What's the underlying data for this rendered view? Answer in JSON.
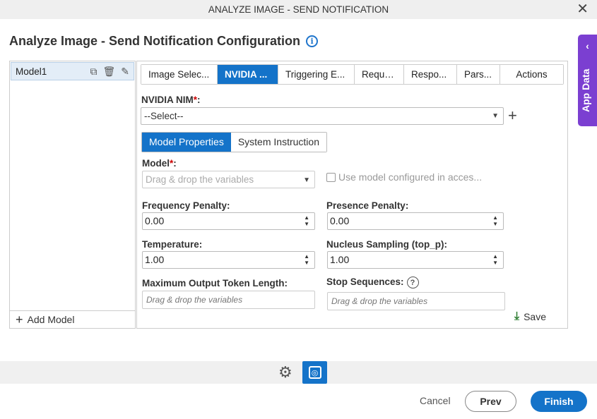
{
  "window": {
    "title": "ANALYZE IMAGE - SEND NOTIFICATION"
  },
  "page": {
    "heading": "Analyze Image - Send Notification Configuration"
  },
  "app_data": {
    "label": "App Data"
  },
  "models": {
    "items": [
      {
        "label": "Model1"
      }
    ],
    "add_label": "Add Model"
  },
  "tabs": [
    {
      "label": "Image Selec...",
      "active": false
    },
    {
      "label": "NVIDIA ...",
      "active": true
    },
    {
      "label": "Triggering E...",
      "active": false
    },
    {
      "label": "Reque...",
      "active": false
    },
    {
      "label": "Respo...",
      "active": false
    },
    {
      "label": "Pars...",
      "active": false
    },
    {
      "label": "Actions",
      "active": false
    }
  ],
  "nim": {
    "label": "NVIDIA NIM",
    "value": "--Select--"
  },
  "subtabs": [
    {
      "label": "Model Properties",
      "active": true
    },
    {
      "label": "System Instruction",
      "active": false
    }
  ],
  "form": {
    "model_label": "Model",
    "model_placeholder": "Drag & drop the variables",
    "use_model_label": "Use model configured in acces...",
    "frequency_label": "Frequency Penalty:",
    "frequency_value": "0.00",
    "presence_label": "Presence Penalty:",
    "presence_value": "0.00",
    "temperature_label": "Temperature:",
    "temperature_value": "1.00",
    "nucleus_label": "Nucleus Sampling (top_p):",
    "nucleus_value": "1.00",
    "max_tokens_label": "Maximum Output Token Length:",
    "max_tokens_placeholder": "Drag & drop the variables",
    "stop_label": "Stop Sequences:",
    "stop_placeholder": "Drag & drop the variables",
    "save_label": "Save"
  },
  "footer": {
    "cancel": "Cancel",
    "prev": "Prev",
    "finish": "Finish"
  }
}
